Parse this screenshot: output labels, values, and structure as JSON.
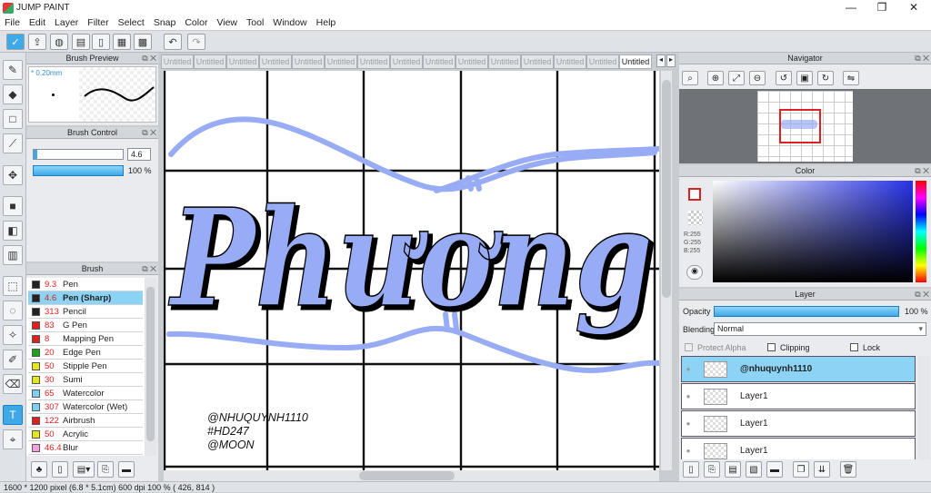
{
  "window": {
    "title": "JUMP PAINT",
    "minimize": "—",
    "restore": "❐",
    "close": "✕"
  },
  "menu": [
    "File",
    "Edit",
    "Layer",
    "Filter",
    "Select",
    "Snap",
    "Color",
    "View",
    "Tool",
    "Window",
    "Help"
  ],
  "brush_preview": {
    "title": "Brush Preview",
    "size_label": "* 0.20mm"
  },
  "brush_control": {
    "title": "Brush Control",
    "size_value": "4.6",
    "opacity_value": "100 %"
  },
  "brush_panel": {
    "title": "Brush",
    "items": [
      {
        "size": "9.3",
        "name": "Pen",
        "color": "#222222"
      },
      {
        "size": "4.6",
        "name": "Pen (Sharp)",
        "color": "#222222"
      },
      {
        "size": "313",
        "name": "Pencil",
        "color": "#222222"
      },
      {
        "size": "83",
        "name": "G Pen",
        "color": "#e02020"
      },
      {
        "size": "8",
        "name": "Mapping Pen",
        "color": "#e02020"
      },
      {
        "size": "20",
        "name": "Edge Pen",
        "color": "#1ea01e"
      },
      {
        "size": "50",
        "name": "Stipple Pen",
        "color": "#e6e61e"
      },
      {
        "size": "30",
        "name": "Sumi",
        "color": "#e6e61e"
      },
      {
        "size": "65",
        "name": "Watercolor",
        "color": "#7fd0f0"
      },
      {
        "size": "307",
        "name": "Watercolor (Wet)",
        "color": "#7fd0f0"
      },
      {
        "size": "122",
        "name": "Airbrush",
        "color": "#e02020"
      },
      {
        "size": "50",
        "name": "Acrylic",
        "color": "#e6e61e"
      },
      {
        "size": "46.4",
        "name": "Blur",
        "color": "#f5a0e0"
      }
    ]
  },
  "tabs": [
    "Untitled",
    "Untitled",
    "Untitled",
    "Untitled",
    "Untitled",
    "Untitled",
    "Untitled",
    "Untitled",
    "Untitled",
    "Untitled",
    "Untitled",
    "Untitled",
    "Untitled",
    "Untitled",
    "Untitled"
  ],
  "canvas": {
    "title_text": "Phương",
    "signature": [
      "@NHUQUYNH1110",
      "#HD247",
      "@MOON"
    ],
    "accent": "#98abf5"
  },
  "navigator": {
    "title": "Navigator"
  },
  "color_panel": {
    "title": "Color",
    "r": "R:255",
    "g": "G:255",
    "b": "B:255"
  },
  "layer_panel": {
    "title": "Layer",
    "opacity_label": "Opacity",
    "opacity_value": "100 %",
    "blending_label": "Blending",
    "blending_value": "Normal",
    "protect_alpha": "Protect Alpha",
    "clipping": "Clipping",
    "lock": "Lock",
    "layers": [
      {
        "name": "@nhuquynh1110",
        "selected": true
      },
      {
        "name": "Layer1",
        "selected": false
      },
      {
        "name": "Layer1",
        "selected": false
      },
      {
        "name": "Layer1",
        "selected": false
      }
    ]
  },
  "status": "1600 * 1200 pixel   (6.8 * 5.1cm)   600 dpi   100 %   ( 426, 814 )"
}
